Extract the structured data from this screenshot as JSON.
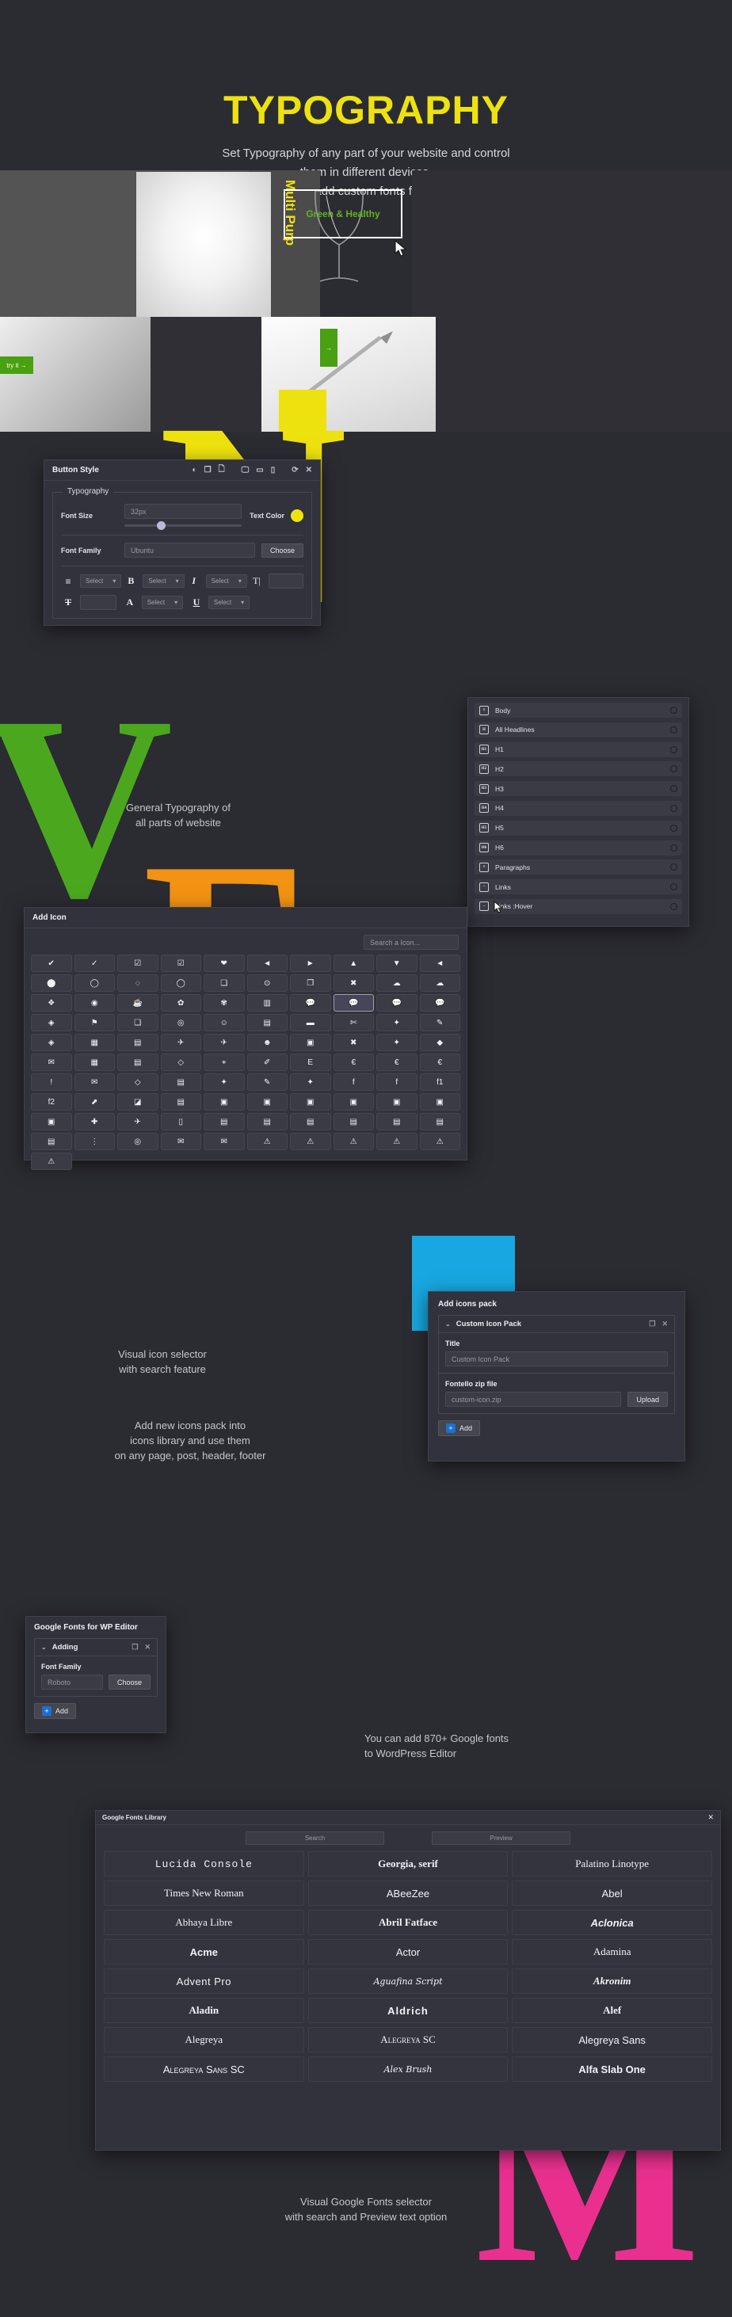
{
  "hero": {
    "title": "TYPOGRAPHY",
    "subtitle_line1": "Set Typography of any part of your website and control",
    "subtitle_line2": "them in different devices.",
    "subtitle_line3": "Use Icons and add custom fonts family with ease.",
    "title_color": "#eee20e"
  },
  "band": {
    "multi_purpose": "Multi Purp",
    "green_healthy": "Green & Healthy",
    "try_it": "try it  →",
    "side_tag": "→"
  },
  "button_style": {
    "title": "Button Style",
    "legend": "Typography",
    "font_size_label": "Font Size",
    "font_size_value": "32px",
    "text_color_label": "Text Color",
    "text_color_value": "#eee20e",
    "font_family_label": "Font Family",
    "font_family_value": "Ubuntu",
    "choose_label": "Choose",
    "controls": [
      {
        "icon": "align-icon",
        "glyph": "≡",
        "select": "Select"
      },
      {
        "icon": "bold-icon",
        "glyph": "B",
        "select": "Select"
      },
      {
        "icon": "italic-icon",
        "glyph": "I",
        "select": "Select"
      },
      {
        "icon": "line-height-icon",
        "glyph": "T|",
        "select": ""
      },
      {
        "icon": "strikethrough-icon",
        "glyph": "T",
        "select": ""
      },
      {
        "icon": "letter-case-icon",
        "glyph": "A",
        "select": "Select"
      },
      {
        "icon": "underline-icon",
        "glyph": "U",
        "select": "Select"
      }
    ],
    "window_tools": [
      "contrast-icon",
      "copy-icon",
      "file-icon",
      "desktop-icon",
      "tablet-icon",
      "mobile-icon",
      "refresh-icon",
      "close-icon"
    ]
  },
  "headings_panel": {
    "items": [
      {
        "badge": "≡",
        "label": "Body",
        "icon": "body-icon"
      },
      {
        "badge": "H",
        "label": "All Headlines",
        "icon": "all-headlines-icon"
      },
      {
        "badge": "H1",
        "label": "H1",
        "icon": "h1-icon"
      },
      {
        "badge": "H2",
        "label": "H2",
        "icon": "h2-icon"
      },
      {
        "badge": "H3",
        "label": "H3",
        "icon": "h3-icon"
      },
      {
        "badge": "H4",
        "label": "H4",
        "icon": "h4-icon"
      },
      {
        "badge": "H5",
        "label": "H5",
        "icon": "h5-icon"
      },
      {
        "badge": "H6",
        "label": "H6",
        "icon": "h6-icon"
      },
      {
        "badge": "≡",
        "label": "Paragraphs",
        "icon": "paragraphs-icon"
      },
      {
        "badge": "–",
        "label": "Links",
        "icon": "links-icon"
      },
      {
        "badge": "–",
        "label": "Links :Hover",
        "icon": "links-hover-icon"
      }
    ]
  },
  "add_icon": {
    "title": "Add Icon",
    "search_placeholder": "Search a Icon...",
    "icons": [
      "✔",
      "✓",
      "☑",
      "☑",
      "❤",
      "◄",
      "►",
      "▲",
      "▼",
      "◄",
      "⬤",
      "◯",
      "◌",
      "◯",
      "❏",
      "⊙",
      "❐",
      "✖",
      "☁",
      "☁",
      "❖",
      "◉",
      "☕",
      "✿",
      "✾",
      "▥",
      "💬",
      "💬",
      "💬",
      "💬",
      "◈",
      "⚑",
      "❑",
      "◎",
      "☺",
      "▤",
      "▬",
      "✄",
      "✦",
      "✎",
      "◈",
      "▦",
      "▤",
      "✈",
      "✈",
      "☻",
      "▣",
      "✖",
      "✦",
      "◆",
      "✉",
      "▦",
      "▤",
      "◇",
      "⌖",
      "✐",
      "E",
      "€",
      "€",
      "€",
      "!",
      "✉",
      "◇",
      "▤",
      "✦",
      "✎",
      "✦",
      "f",
      "f",
      "f1",
      "f2",
      "⬈",
      "◪",
      "▤",
      "▣",
      "▣",
      "▣",
      "▣",
      "▣",
      "▣",
      "▣",
      "✚",
      "✈",
      "▯",
      "▤",
      "▤",
      "▤",
      "▤",
      "▤",
      "▤",
      "▤"
    ],
    "extra_row_icons": [
      "⋮",
      "◎",
      "✉",
      "✉",
      "⚠",
      "⚠",
      "⚠",
      "⚠",
      "⚠",
      "⚠"
    ]
  },
  "icons_pack": {
    "title": "Add icons pack",
    "card_title": "Custom Icon Pack",
    "title_label": "Title",
    "title_placeholder": "Custom Icon Pack",
    "zip_label": "Fontello zip file",
    "zip_placeholder": "custom-icon.zip",
    "upload_label": "Upload",
    "add_label": "Add"
  },
  "google_fonts_wp": {
    "title": "Google Fonts for WP Editor",
    "card_title": "Adding",
    "font_family_label": "Font Family",
    "font_family_placeholder": "Roboto",
    "choose_label": "Choose",
    "add_label": "Add"
  },
  "google_fonts_library": {
    "title": "Google Fonts Library",
    "search_placeholder": "Search",
    "preview_placeholder": "Preview",
    "fonts": [
      "Lucida Console",
      "Georgia, serif",
      "Palatino Linotype",
      "Times New Roman",
      "ABeeZee",
      "Abel",
      "Abhaya Libre",
      "Abril Fatface",
      "Aclonica",
      "Acme",
      "Actor",
      "Adamina",
      "Advent Pro",
      "Aguafina Script",
      "Akronim",
      "Aladin",
      "Aldrich",
      "Alef",
      "Alegreya",
      "Alegreya SC",
      "Alegreya Sans",
      "Alegreya Sans SC",
      "Alex Brush",
      "Alfa Slab One"
    ]
  },
  "captions": {
    "general_typography_l1": "General Typography of",
    "general_typography_l2": "all parts of website",
    "visual_icon_l1": "Visual icon selector",
    "visual_icon_l2": "with search feature",
    "add_pack_l1": "Add new icons pack into",
    "add_pack_l2": "icons library and use them",
    "add_pack_l3": "on any page, post, header, footer",
    "gfonts_l1": "You can add 870+ Google fonts",
    "gfonts_l2": "to WordPress Editor",
    "selector_l1": "Visual Google Fonts selector",
    "selector_l2": "with search and Preview text option"
  }
}
